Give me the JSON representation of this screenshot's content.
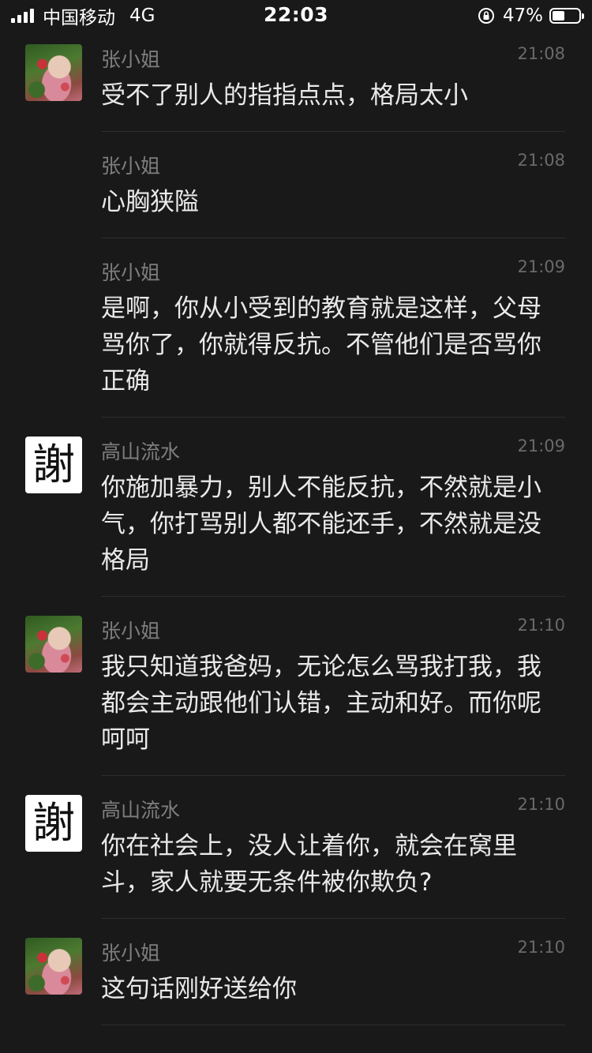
{
  "status_bar": {
    "carrier": "中国移动",
    "network": "4G",
    "time": "22:03",
    "battery_percent": "47%",
    "battery_level": 0.47
  },
  "messages": [
    {
      "sender": "张小姐",
      "time": "21:08",
      "avatar": "photo",
      "show_avatar": true,
      "text": "受不了别人的指指点点，格局太小"
    },
    {
      "sender": "张小姐",
      "time": "21:08",
      "avatar": "photo",
      "show_avatar": false,
      "text": "心胸狭隘"
    },
    {
      "sender": "张小姐",
      "time": "21:09",
      "avatar": "photo",
      "show_avatar": false,
      "text": "是啊，你从小受到的教育就是这样，父母骂你了，你就得反抗。不管他们是否骂你正确"
    },
    {
      "sender": "高山流水",
      "time": "21:09",
      "avatar": "char",
      "avatar_char": "謝",
      "show_avatar": true,
      "text": "你施加暴力，别人不能反抗，不然就是小气，你打骂别人都不能还手，不然就是没格局"
    },
    {
      "sender": "张小姐",
      "time": "21:10",
      "avatar": "photo",
      "show_avatar": true,
      "text": "我只知道我爸妈，无论怎么骂我打我，我都会主动跟他们认错，主动和好。而你呢 呵呵"
    },
    {
      "sender": "高山流水",
      "time": "21:10",
      "avatar": "char",
      "avatar_char": "謝",
      "show_avatar": true,
      "text": "你在社会上，没人让着你，就会在窝里斗，家人就要无条件被你欺负?"
    },
    {
      "sender": "张小姐",
      "time": "21:10",
      "avatar": "photo",
      "show_avatar": true,
      "text": "这句话刚好送给你"
    }
  ]
}
